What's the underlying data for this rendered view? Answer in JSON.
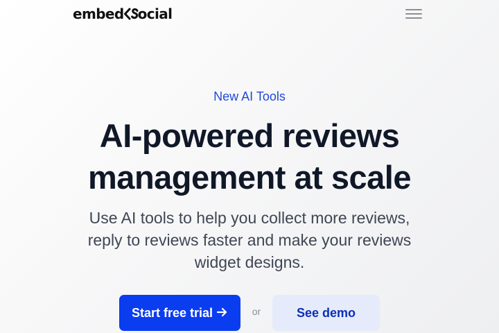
{
  "header": {
    "logo_prefix": "embed",
    "logo_suffix": "ocial",
    "logo_mark_icon": "embed-chevron-s-icon",
    "menu_icon": "hamburger-menu-icon"
  },
  "hero": {
    "eyebrow": "New AI Tools",
    "title_line1": "AI-powered reviews",
    "title_line2": "management at scale",
    "subtitle": "Use AI tools to help you collect more reviews, reply to reviews faster and make your reviews widget designs."
  },
  "cta": {
    "primary_label": "Start free trial",
    "primary_icon": "arrow-right-icon",
    "or_label": "or",
    "secondary_label": "See demo"
  },
  "colors": {
    "accent": "#0b3df0",
    "eyebrow": "#1f4bd8",
    "secondary_bg": "#e6ebfb",
    "heading": "#101828"
  }
}
